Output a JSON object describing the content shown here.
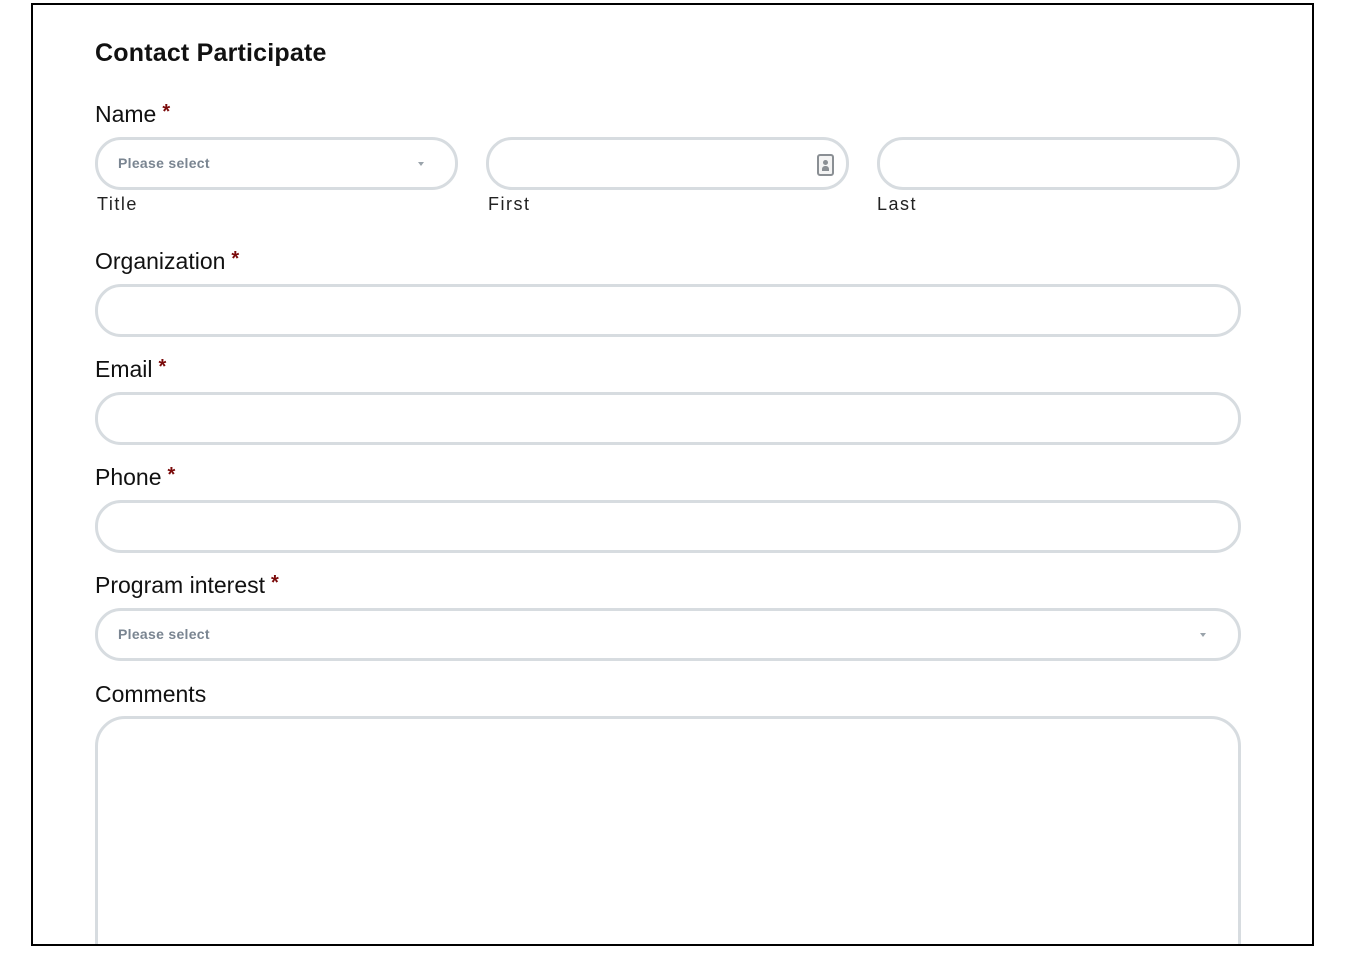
{
  "form": {
    "title": "Contact Participate",
    "required_marker": "*",
    "name": {
      "label": "Name",
      "title_field": {
        "placeholder": "Please select",
        "sublabel": "Title"
      },
      "first_field": {
        "value": "",
        "sublabel": "First",
        "icon": "contact-card-icon"
      },
      "last_field": {
        "value": "",
        "sublabel": "Last"
      }
    },
    "organization": {
      "label": "Organization",
      "value": ""
    },
    "email": {
      "label": "Email",
      "value": ""
    },
    "phone": {
      "label": "Phone",
      "value": ""
    },
    "program_interest": {
      "label": "Program interest",
      "placeholder": "Please select"
    },
    "comments": {
      "label": "Comments",
      "value": ""
    }
  },
  "colors": {
    "required": "#7a0a0a",
    "input_border": "#d7dce0",
    "placeholder_text": "#7a8591"
  }
}
